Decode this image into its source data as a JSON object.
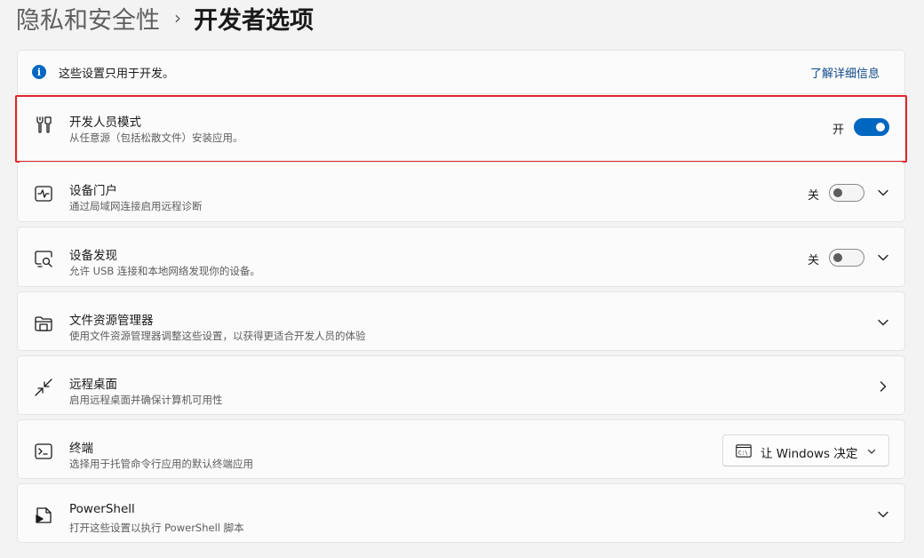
{
  "breadcrumb": {
    "parent": "隐私和安全性",
    "separator": "›",
    "current": "开发者选项"
  },
  "info": {
    "icon": "info-icon",
    "text": "这些设置只用于开发。",
    "link": "了解详细信息"
  },
  "rows": {
    "developer_mode": {
      "icon": "developer-tools-icon",
      "title": "开发人员模式",
      "desc": "从任意源（包括松散文件）安装应用。",
      "state_label": "开",
      "toggle_on": true
    },
    "device_portal": {
      "icon": "pulse-monitor-icon",
      "title": "设备门户",
      "desc": "通过局域网连接启用远程诊断",
      "state_label": "关",
      "toggle_on": false
    },
    "device_discovery": {
      "icon": "device-search-icon",
      "title": "设备发现",
      "desc": "允许 USB 连接和本地网络发现你的设备。",
      "state_label": "关",
      "toggle_on": false
    },
    "file_explorer": {
      "icon": "folder-icon",
      "title": "文件资源管理器",
      "desc": "使用文件资源管理器调整这些设置，以获得更适合开发人员的体验"
    },
    "remote_desktop": {
      "icon": "remote-desktop-icon",
      "title": "远程桌面",
      "desc": "启用远程桌面并确保计算机可用性"
    },
    "terminal": {
      "icon": "terminal-icon",
      "title": "终端",
      "desc": "选择用于托管命令行应用的默认终端应用",
      "dropdown_value": "让 Windows 决定",
      "dropdown_icon": "console-window-icon"
    },
    "powershell": {
      "icon": "powershell-icon",
      "title": "PowerShell",
      "desc": "打开这些设置以执行 PowerShell 脚本"
    }
  },
  "colors": {
    "accent": "#0067c0",
    "highlight_border": "#e0262b",
    "background": "#f3f3f3",
    "card": "#fbfbfb"
  }
}
